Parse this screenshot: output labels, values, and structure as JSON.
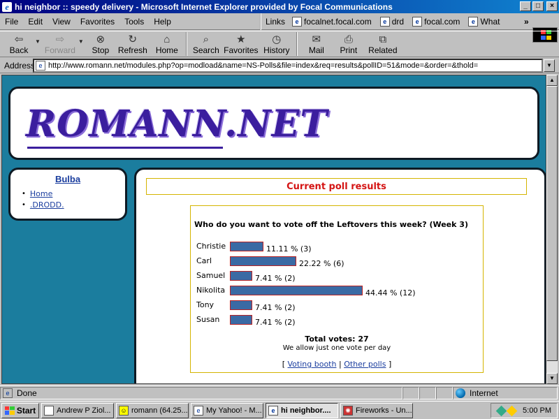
{
  "window": {
    "title": "hi neighbor :: speedy delivery - Microsoft Internet Explorer provided by Focal Communications",
    "minimize": "_",
    "maximize": "□",
    "close": "×"
  },
  "menu": {
    "items": [
      "File",
      "Edit",
      "View",
      "Favorites",
      "Tools",
      "Help"
    ],
    "links_label": "Links",
    "links": [
      "focalnet.focal.com",
      "drd",
      "focal.com",
      "What"
    ],
    "more": "»"
  },
  "toolbar": {
    "back": "Back",
    "forward": "Forward",
    "stop": "Stop",
    "refresh": "Refresh",
    "home": "Home",
    "search": "Search",
    "favorites": "Favorites",
    "history": "History",
    "mail": "Mail",
    "print": "Print",
    "related": "Related"
  },
  "address": {
    "label": "Address",
    "url": "http://www.romann.net/modules.php?op=modload&name=NS-Polls&file=index&req=results&pollID=51&mode=&order=&thold="
  },
  "site": {
    "logo": "ROMANN.NET"
  },
  "sidebar": {
    "title": "Bulba",
    "items": [
      "Home",
      ".DRODD."
    ]
  },
  "poll": {
    "header": "Current poll results",
    "question": "Who do you want to vote off the Leftovers this week? (Week 3)",
    "total": "Total votes: 27",
    "note": "We allow just one vote per day",
    "bracket_open": "[",
    "separator": "|",
    "bracket_close": "]",
    "link_booth": "Voting booth",
    "link_other": "Other polls"
  },
  "chart_data": {
    "type": "bar",
    "categories": [
      "Christie",
      "Carl",
      "Samuel",
      "Nikolita",
      "Tony",
      "Susan"
    ],
    "values": [
      3,
      6,
      2,
      12,
      2,
      2
    ],
    "percents": [
      11.11,
      22.22,
      7.41,
      44.44,
      7.41,
      7.41
    ],
    "labels": [
      "11.11 % (3)",
      "22.22 % (6)",
      "7.41 % (2)",
      "44.44 % (12)",
      "7.41 % (2)",
      "7.41 % (2)"
    ],
    "bar_color": "#3a6aa4",
    "title": "Who do you want to vote off the Leftovers this week? (Week 3)"
  },
  "status": {
    "text": "Done",
    "zone": "Internet"
  },
  "taskbar": {
    "start": "Start",
    "tasks": [
      "Andrew P Ziol...",
      "romann (64.25...",
      "My Yahoo! - M...",
      "hi neighbor....",
      "Fireworks - Un..."
    ],
    "clock": "5:00 PM"
  }
}
